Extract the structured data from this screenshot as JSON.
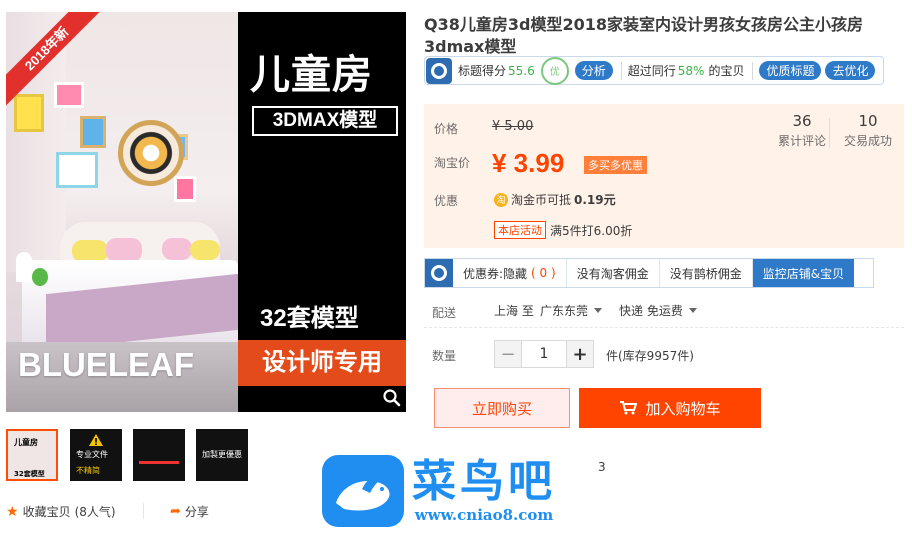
{
  "gallery": {
    "ribbon": "2018年新",
    "brand": "BLUELEAF",
    "headline": "儿童房",
    "badge": "3DMAX模型",
    "sets": "32套模型",
    "designer": "设计师专用",
    "thumbs": [
      {
        "line1": "儿童房",
        "line2": "32套模型"
      },
      {
        "line1": "专业文件",
        "line2": "不精简"
      },
      {
        "line1": "",
        "line2": ""
      },
      {
        "line1": "加製更優惠",
        "line2": ""
      }
    ]
  },
  "footer": {
    "favorite_label": "收藏宝贝",
    "favorite_count": "(8人气)",
    "share_label": "分享"
  },
  "product": {
    "title": "Q38儿童房3d模型2018家装室内设计男孩女孩房公主小孩房3dmax模型"
  },
  "seo": {
    "title_score_label": "标题得分",
    "title_score": "55.6",
    "stamp": "优",
    "analyze": "分析",
    "beat_label": "超过同行",
    "beat_pct": "58%",
    "beat_suffix": "的宝贝",
    "quality_title": "优质标题",
    "optimize": "去优化"
  },
  "price": {
    "price_label": "价格",
    "old_price": "¥ 5.00",
    "taobao_label": "淘宝价",
    "new_price": "¥ 3.99",
    "promo": "多买多优惠",
    "reviews_num": "36",
    "reviews_label": "累计评论",
    "deals_num": "10",
    "deals_label": "交易成功",
    "discount_label": "优惠",
    "coin_text": "淘金币可抵",
    "coin_value": "0.19元",
    "coin_glyph": "淘",
    "shop_tag": "本店活动",
    "shop_text": "满5件打6.00折"
  },
  "coupon": {
    "coupon_label": "优惠券:隐藏",
    "coupon_count": "( 0 )",
    "no_commission": "没有淘客佣金",
    "no_bridge": "没有鹊桥佣金",
    "monitor": "监控店铺&宝贝"
  },
  "shipping": {
    "label": "配送",
    "from": "上海 至",
    "to": "广东东莞",
    "express": "快递 免运费"
  },
  "quantity": {
    "label": "数量",
    "minus": "−",
    "value": "1",
    "plus": "+",
    "stock": "件(库存9957件)"
  },
  "actions": {
    "buy_now": "立即购买",
    "add_cart": "加入购物车"
  },
  "watermark": {
    "cn": "菜鸟吧",
    "url": "www.cniao8.com",
    "tail": "3"
  },
  "colors": {
    "accent": "#ff4400",
    "blue": "#2f7ac8",
    "price_bg": "#fff2e8"
  }
}
